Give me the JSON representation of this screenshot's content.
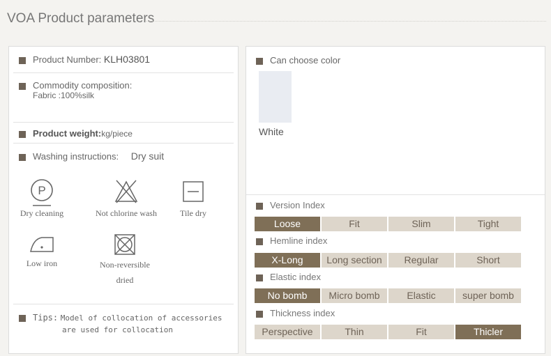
{
  "page_title": "VOA Product parameters",
  "left": {
    "product_number": {
      "label": "Product Number:",
      "value": "KLH03801"
    },
    "composition": {
      "label": "Commodity composition:",
      "fabric": "Fabric  :100%silk"
    },
    "weight": {
      "label": "Product  weight:",
      "value": "kg/piece"
    },
    "washing": {
      "label": "Washing instructions:",
      "value": "Dry suit"
    },
    "care": [
      {
        "label": "Dry cleaning",
        "icon": "dry-cleaning-icon"
      },
      {
        "label": "Not chlorine wash",
        "icon": "no-chlorine-icon"
      },
      {
        "label": "Tile dry",
        "icon": "tile-dry-icon"
      },
      {
        "label": "Low iron",
        "icon": "low-iron-icon"
      },
      {
        "label": "Non-reversible",
        "label2": "dried",
        "icon": "no-tumble-dry-icon"
      }
    ],
    "tips": {
      "label": "Tips:",
      "line1": "Model of collocation of accessories",
      "line2": "are used for collocation"
    }
  },
  "right": {
    "color_label": "Can choose color",
    "color_name": "White",
    "indices": [
      {
        "label": "Version Index",
        "options": [
          "Loose",
          "Fit",
          "Slim",
          "Tight"
        ],
        "selected": 0
      },
      {
        "label": "Hemline index",
        "options": [
          "X-Long",
          "Long section",
          "Regular",
          "Short"
        ],
        "selected": 0
      },
      {
        "label": "Elastic index",
        "options": [
          "No bomb",
          "Micro bomb",
          "Elastic",
          "super bomb"
        ],
        "selected": 0
      },
      {
        "label": "Thickness index",
        "options": [
          "Perspective",
          "Thin",
          "Fit",
          "Thicler"
        ],
        "selected": 3
      }
    ]
  },
  "colors": {
    "accent": "#7f6f57",
    "cell_bg": "#ddd6cb",
    "bullet": "#6e6357"
  }
}
